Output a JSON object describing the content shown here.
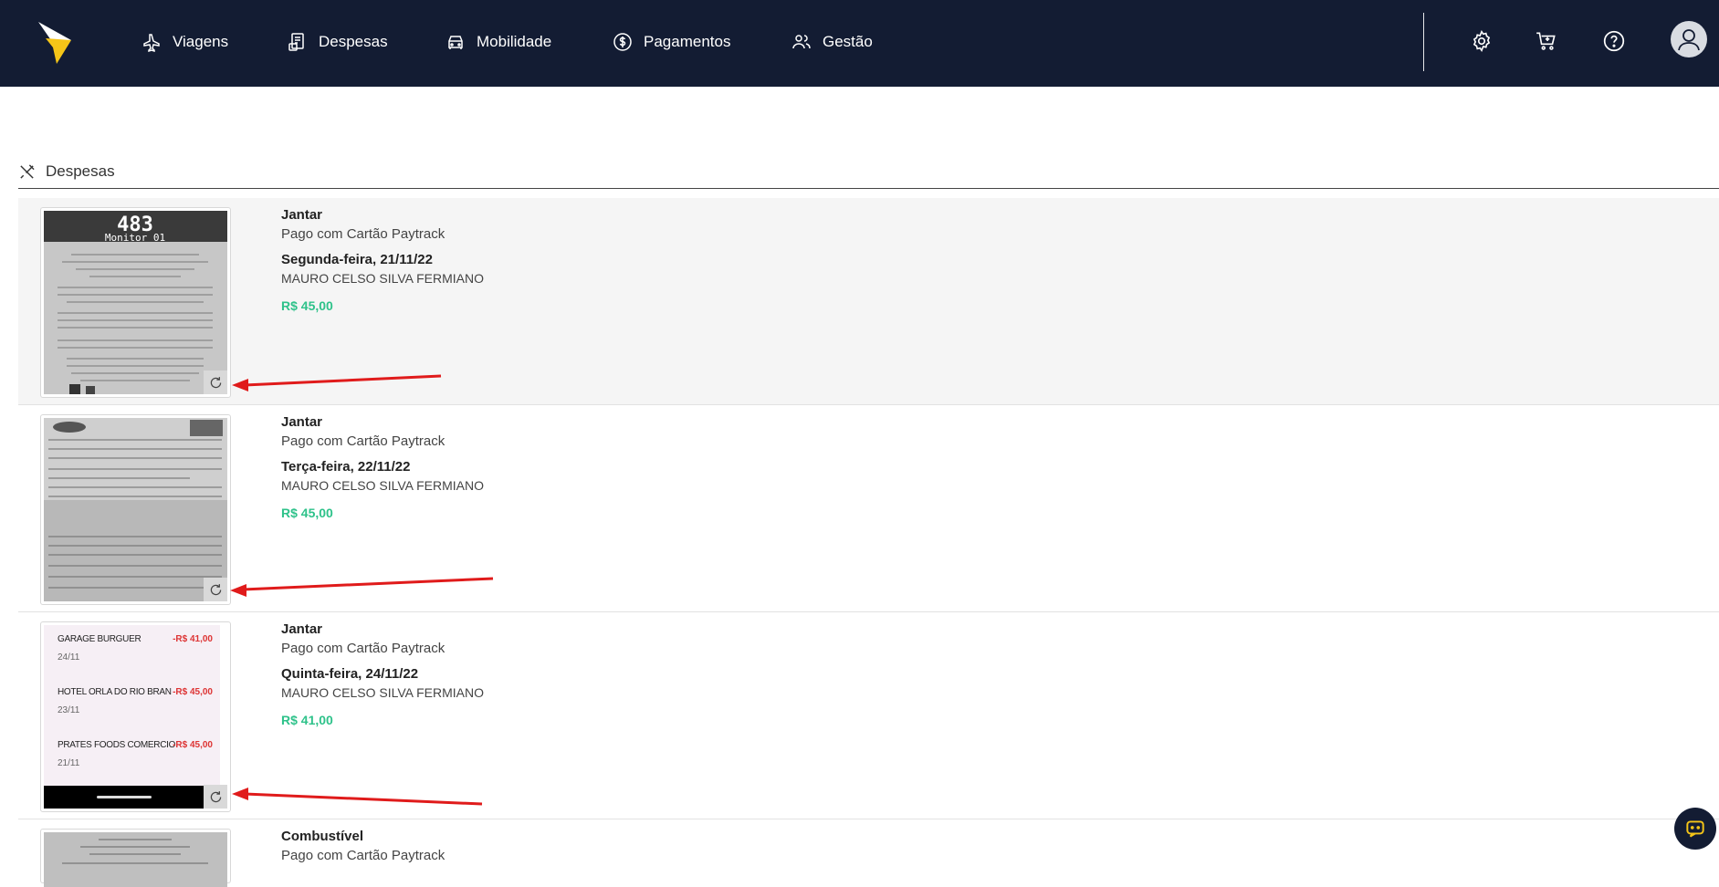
{
  "nav": {
    "items": [
      {
        "label": "Viagens",
        "icon": "plane-icon"
      },
      {
        "label": "Despesas",
        "icon": "receipt-icon"
      },
      {
        "label": "Mobilidade",
        "icon": "car-icon"
      },
      {
        "label": "Pagamentos",
        "icon": "dollar-icon"
      },
      {
        "label": "Gestão",
        "icon": "users-icon"
      }
    ],
    "right_icons": [
      "gear-icon",
      "cart-plus-icon",
      "help-icon",
      "user-icon"
    ]
  },
  "section": {
    "title": "Despesas",
    "icon": "utensils-icon"
  },
  "expenses": [
    {
      "category": "Jantar",
      "payment": "Pago com Cartão Paytrack",
      "date": "Segunda-feira, 21/11/22",
      "person": "MAURO CELSO SILVA FERMIANO",
      "amount": "R$ 45,00"
    },
    {
      "category": "Jantar",
      "payment": "Pago com Cartão Paytrack",
      "date": "Terça-feira, 22/11/22",
      "person": "MAURO CELSO SILVA FERMIANO",
      "amount": "R$ 45,00"
    },
    {
      "category": "Jantar",
      "payment": "Pago com Cartão Paytrack",
      "date": "Quinta-feira, 24/11/22",
      "person": "MAURO CELSO SILVA FERMIANO",
      "amount": "R$ 41,00"
    },
    {
      "category": "Combustível",
      "payment": "Pago com Cartão Paytrack",
      "date": "",
      "person": "",
      "amount": ""
    }
  ],
  "receipt1": {
    "ticket": "483",
    "sub": "Monitor 01"
  },
  "receipt3": {
    "lines": [
      {
        "name": "GARAGE BURGUER",
        "date": "24/11",
        "value": "-R$ 41,00"
      },
      {
        "name": "HOTEL ORLA DO RIO BRAN",
        "date": "23/11",
        "value": "-R$ 45,00"
      },
      {
        "name": "PRATES FOODS COMERCIO",
        "date": "21/11",
        "value": "-R$ 45,00"
      }
    ]
  },
  "colors": {
    "topbar": "#131c33",
    "accent": "#f5c518",
    "amount": "#2ec28a",
    "annotation": "#e01b1b"
  }
}
